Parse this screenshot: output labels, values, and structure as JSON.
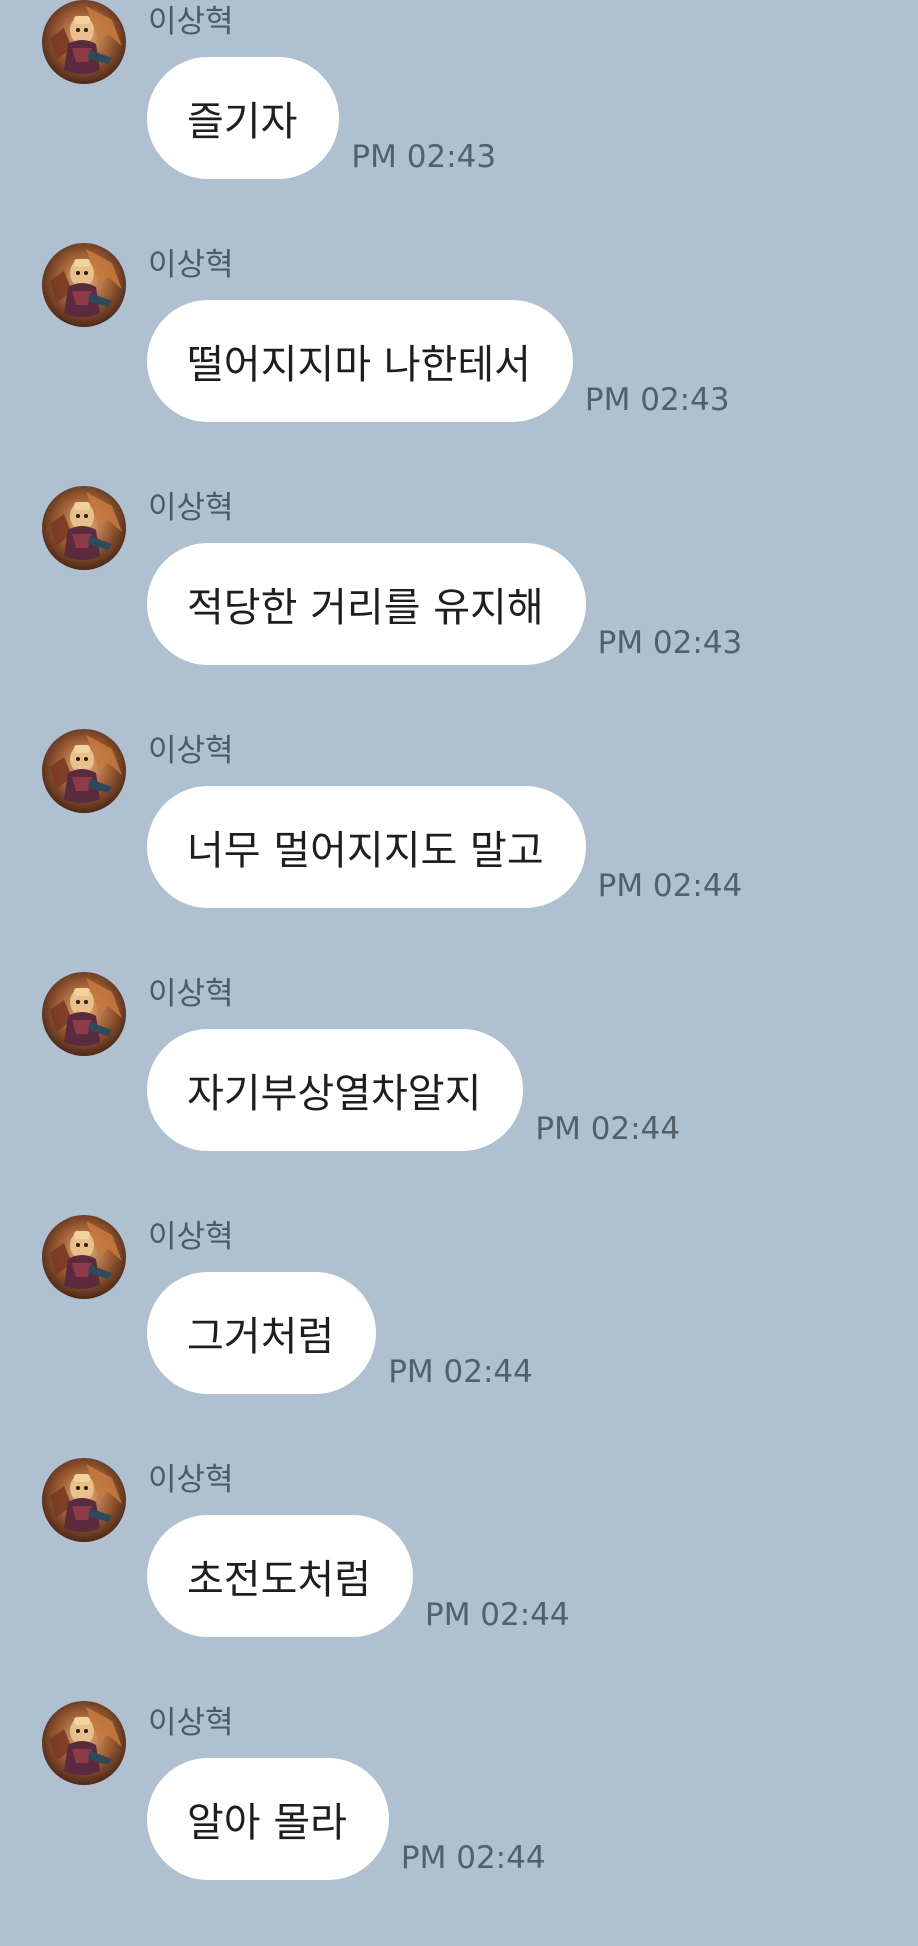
{
  "sender_name": "이상혁",
  "avatar_icon": "champion-portrait-avatar",
  "messages": [
    {
      "text": "즐기자",
      "time": "PM 02:43"
    },
    {
      "text": "떨어지지마 나한테서",
      "time": "PM 02:43"
    },
    {
      "text": "적당한 거리를 유지해",
      "time": "PM 02:43"
    },
    {
      "text": "너무 멀어지지도 말고",
      "time": "PM 02:44"
    },
    {
      "text": "자기부상열차알지",
      "time": "PM 02:44"
    },
    {
      "text": "그거처럼",
      "time": "PM 02:44"
    },
    {
      "text": "초전도처럼",
      "time": "PM 02:44"
    },
    {
      "text": "알아 몰라",
      "time": "PM 02:44"
    }
  ],
  "colors": {
    "background": "#afc0d0",
    "bubble": "#ffffff",
    "text": "#1e1e1e",
    "meta": "#535f6b"
  }
}
